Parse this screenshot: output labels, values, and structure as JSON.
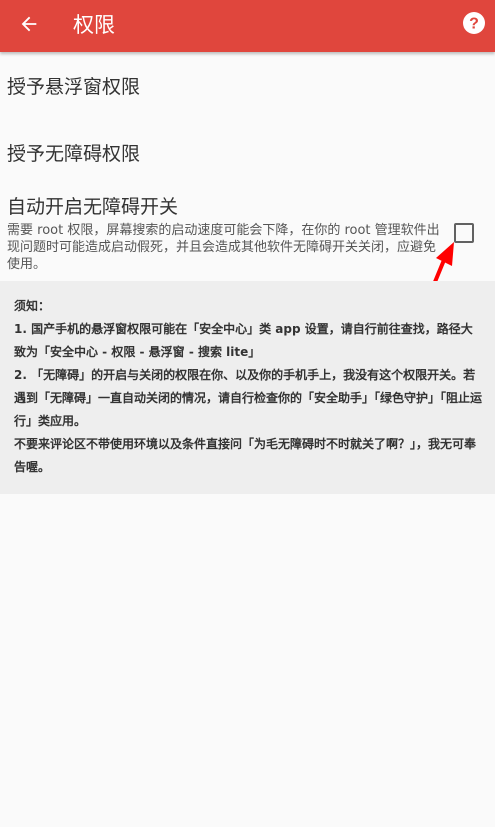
{
  "appbar": {
    "title": "权限",
    "back_icon": "arrow-left-icon",
    "help_icon": "question-circle-icon",
    "color": "#e0463d"
  },
  "settings": {
    "floating_window": {
      "title": "授予悬浮窗权限"
    },
    "accessibility": {
      "title": "授予无障碍权限"
    },
    "auto_accessibility": {
      "title": "自动开启无障碍开关",
      "description": "需要 root 权限，屏幕搜索的启动速度可能会下降，在你的 root 管理软件出现问题时可能造成启动假死，并且会造成其他软件无障碍开关关闭，应避免使用。",
      "checked": false
    }
  },
  "notice": {
    "heading": "须知：",
    "lines": [
      "1. 国产手机的悬浮窗权限可能在「安全中心」类 app 设置，请自行前往查找，路径大致为「安全中心 - 权限 - 悬浮窗 - 搜索 lite」",
      "2. 「无障碍」的开启与关闭的权限在你、以及你的手机手上，我没有这个权限开关。若遇到「无障碍」一直自动关闭的情况，请自行检查你的「安全助手」「绿色守护」「阻止运行」类应用。",
      "不要来评论区不带使用环境以及条件直接问「为毛无障碍时不时就关了啊？」，我无可奉告喔。"
    ]
  },
  "annotation": {
    "arrow_color": "#ff0000"
  }
}
